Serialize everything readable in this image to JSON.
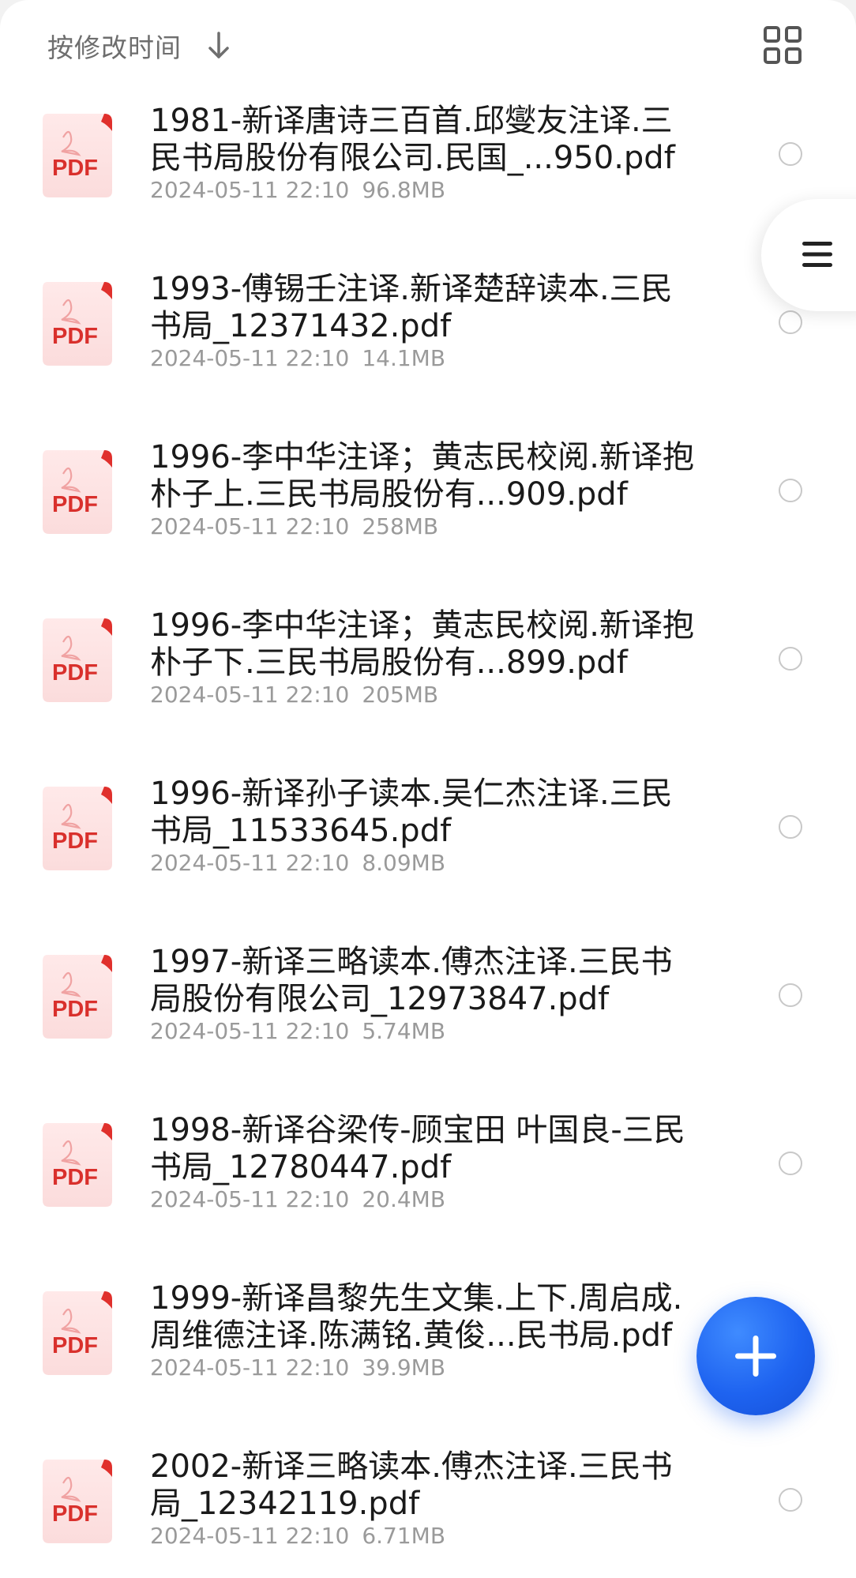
{
  "header": {
    "sort_label": "按修改时间",
    "sort_direction_icon": "arrow-down-icon",
    "view_toggle_icon": "grid-view-icon"
  },
  "colors": {
    "pdf_red": "#d9302c",
    "fab_blue": "#1e63f0",
    "meta_gray": "#9a9a9a"
  },
  "file_icon_label": "PDF",
  "files": [
    {
      "name": "1981-新译唐诗三百首.邱燮友注译.三民书局股份有限公司.民国_...950.pdf",
      "modified": "2024-05-11 22:10",
      "size": "96.8MB"
    },
    {
      "name": "1993-傅锡壬注译.新译楚辞读本.三民书局_12371432.pdf",
      "modified": "2024-05-11 22:10",
      "size": "14.1MB"
    },
    {
      "name": "1996-李中华注译；黄志民校阅.新译抱朴子上.三民书局股份有...909.pdf",
      "modified": "2024-05-11 22:10",
      "size": "258MB"
    },
    {
      "name": "1996-李中华注译；黄志民校阅.新译抱朴子下.三民书局股份有...899.pdf",
      "modified": "2024-05-11 22:10",
      "size": "205MB"
    },
    {
      "name": "1996-新译孙子读本.吴仁杰注译.三民书局_11533645.pdf",
      "modified": "2024-05-11 22:10",
      "size": "8.09MB"
    },
    {
      "name": "1997-新译三略读本.傅杰注译.三民书局股份有限公司_12973847.pdf",
      "modified": "2024-05-11 22:10",
      "size": "5.74MB"
    },
    {
      "name": "1998-新译谷梁传-顾宝田 叶国良-三民书局_12780447.pdf",
      "modified": "2024-05-11 22:10",
      "size": "20.4MB"
    },
    {
      "name": "1999-新译昌黎先生文集.上下.周启成.周维德注译.陈满铭.黄俊...民书局.pdf",
      "modified": "2024-05-11 22:10",
      "size": "39.9MB"
    },
    {
      "name": "2002-新译三略读本.傅杰注译.三民书局_12342119.pdf",
      "modified": "2024-05-11 22:10",
      "size": "6.71MB"
    }
  ],
  "side_menu_icon": "menu-icon",
  "fab_icon": "plus-icon"
}
